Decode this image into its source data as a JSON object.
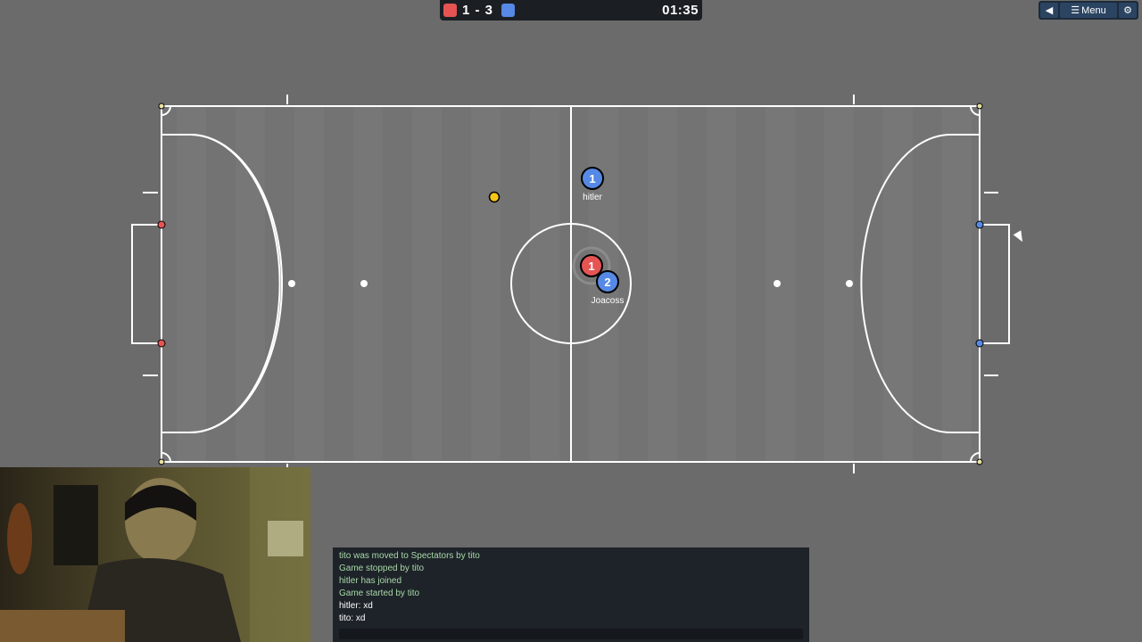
{
  "scoreboard": {
    "score": "1 - 3",
    "timer": "01:35",
    "red_color": "#e55353",
    "blue_color": "#5689e5"
  },
  "menu": {
    "sound_icon": "speaker-icon",
    "menu_label": "Menu",
    "menu_icon": "hamburger-icon",
    "settings_icon": "gear-icon"
  },
  "players": [
    {
      "number": "1",
      "team": "blue",
      "name": "hitler"
    },
    {
      "number": "1",
      "team": "red",
      "name": ""
    },
    {
      "number": "2",
      "team": "blue",
      "name": "Joacoss"
    }
  ],
  "chat": {
    "lines": [
      {
        "text": "tito was moved to Spectators by tito",
        "kind": "notice"
      },
      {
        "text": "Game stopped by tito",
        "kind": "notice"
      },
      {
        "text": "hitler has joined",
        "kind": "notice"
      },
      {
        "text": "Game started by tito",
        "kind": "notice"
      },
      {
        "text": "hitler: xd",
        "kind": "msg"
      },
      {
        "text": "tito: xd",
        "kind": "msg"
      }
    ]
  }
}
